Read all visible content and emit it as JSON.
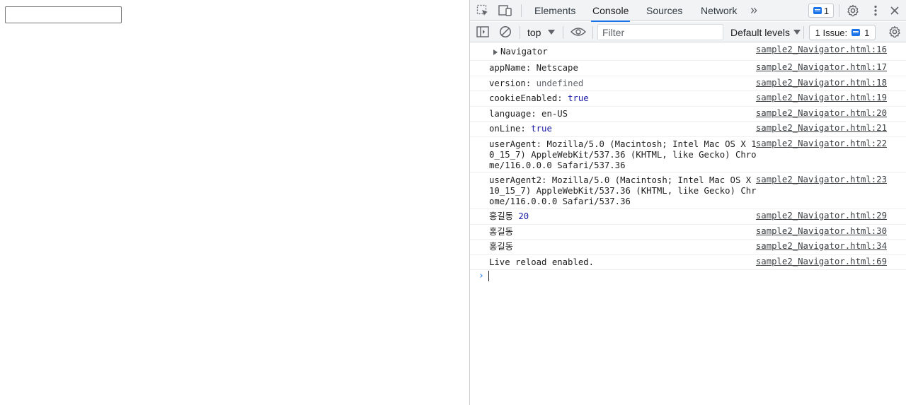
{
  "devtools": {
    "tabs": [
      "Elements",
      "Console",
      "Sources",
      "Network"
    ],
    "active_tab": "Console",
    "more_tabs_glyph": "»",
    "messages_count": "1",
    "toolbar": {
      "context": "top",
      "filter_placeholder": "Filter",
      "levels_label": "Default levels",
      "issues_label": "1 Issue:",
      "issues_count": "1"
    }
  },
  "console": {
    "rows": [
      {
        "type": "object",
        "label": "Navigator",
        "source": "sample2_Navigator.html:16"
      },
      {
        "key": "appName: ",
        "value": "Netscape",
        "value_kind": "string",
        "source": "sample2_Navigator.html:17"
      },
      {
        "key": "version: ",
        "value": "undefined",
        "value_kind": "undefined",
        "source": "sample2_Navigator.html:18"
      },
      {
        "key": "cookieEnabled: ",
        "value": "true",
        "value_kind": "keyword",
        "source": "sample2_Navigator.html:19"
      },
      {
        "key": "language: ",
        "value": "en-US",
        "value_kind": "string",
        "source": "sample2_Navigator.html:20"
      },
      {
        "key": "onLine: ",
        "value": "true",
        "value_kind": "keyword",
        "source": "sample2_Navigator.html:21"
      },
      {
        "key": "userAgent: ",
        "value": "Mozilla/5.0 (Macintosh; Intel Mac OS X 10_15_7) AppleWebKit/537.36 (KHTML, like Gecko) Chrome/116.0.0.0 Safari/537.36",
        "value_kind": "string",
        "source": "sample2_Navigator.html:22"
      },
      {
        "key": "userAgent2: ",
        "value": "Mozilla/5.0 (Macintosh; Intel Mac OS X 10_15_7) AppleWebKit/537.36 (KHTML, like Gecko) Chrome/116.0.0.0 Safari/537.36",
        "value_kind": "string",
        "source": "sample2_Navigator.html:23"
      },
      {
        "key": "홍길동 ",
        "value": "20",
        "value_kind": "number",
        "source": "sample2_Navigator.html:29"
      },
      {
        "key": "홍길동",
        "value": "",
        "value_kind": "string",
        "source": "sample2_Navigator.html:30"
      },
      {
        "key": "홍길동",
        "value": "",
        "value_kind": "string",
        "source": "sample2_Navigator.html:34"
      },
      {
        "key": "Live reload enabled.",
        "value": "",
        "value_kind": "string",
        "source": "sample2_Navigator.html:69"
      }
    ],
    "prompt_glyph": "›"
  }
}
